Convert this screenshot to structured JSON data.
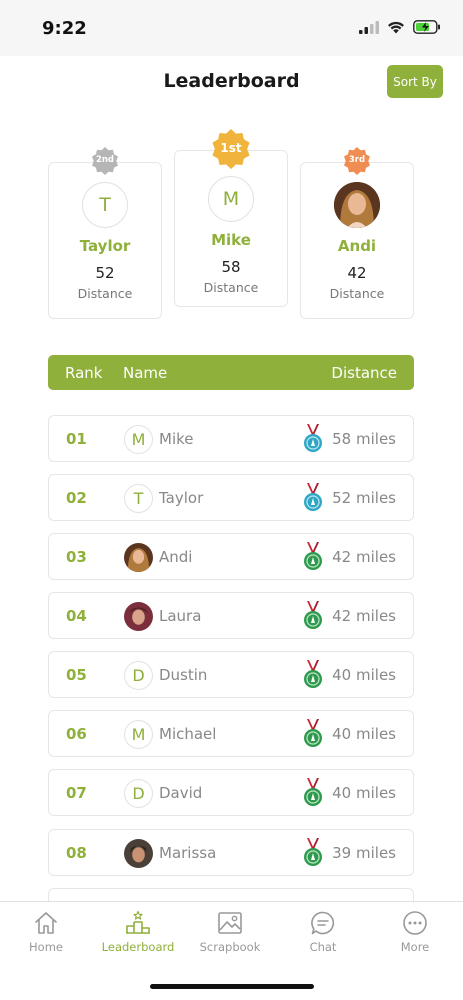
{
  "status": {
    "time": "9:22"
  },
  "header": {
    "title": "Leaderboard",
    "sort_label": "Sort By"
  },
  "podium": [
    {
      "badge": "2nd",
      "badge_color": "#b5b5b5",
      "initial": "T",
      "name": "Taylor",
      "value": "52",
      "unit": "Distance"
    },
    {
      "badge": "1st",
      "badge_color": "#f0b43c",
      "initial": "M",
      "name": "Mike",
      "value": "58",
      "unit": "Distance"
    },
    {
      "badge": "3rd",
      "badge_color": "#f08d52",
      "initial": "",
      "name": "Andi",
      "value": "42",
      "unit": "Distance"
    }
  ],
  "table": {
    "col_rank": "Rank",
    "col_name": "Name",
    "col_distance": "Distance",
    "rows": [
      {
        "rank": "01",
        "initial": "M",
        "name": "Mike",
        "distance": "58 miles",
        "medal": "blue"
      },
      {
        "rank": "02",
        "initial": "T",
        "name": "Taylor",
        "distance": "52 miles",
        "medal": "blue"
      },
      {
        "rank": "03",
        "initial": "",
        "name": "Andi",
        "distance": "42 miles",
        "medal": "green"
      },
      {
        "rank": "04",
        "initial": "",
        "name": "Laura",
        "distance": "42 miles",
        "medal": "green"
      },
      {
        "rank": "05",
        "initial": "D",
        "name": "Dustin",
        "distance": "40 miles",
        "medal": "green"
      },
      {
        "rank": "06",
        "initial": "M",
        "name": "Michael",
        "distance": "40 miles",
        "medal": "green"
      },
      {
        "rank": "07",
        "initial": "D",
        "name": "David",
        "distance": "40 miles",
        "medal": "green"
      },
      {
        "rank": "08",
        "initial": "",
        "name": "Marissa",
        "distance": "39 miles",
        "medal": "green"
      }
    ]
  },
  "tabs": [
    {
      "label": "Home",
      "icon": "home-icon"
    },
    {
      "label": "Leaderboard",
      "icon": "podium-icon",
      "active": true
    },
    {
      "label": "Scrapbook",
      "icon": "image-icon"
    },
    {
      "label": "Chat",
      "icon": "chat-icon"
    },
    {
      "label": "More",
      "icon": "more-icon"
    }
  ],
  "colors": {
    "accent": "#8fb03a",
    "medal_blue": "#2fa6c4",
    "medal_green": "#2f9a4e",
    "ribbon": "#c9283a"
  }
}
